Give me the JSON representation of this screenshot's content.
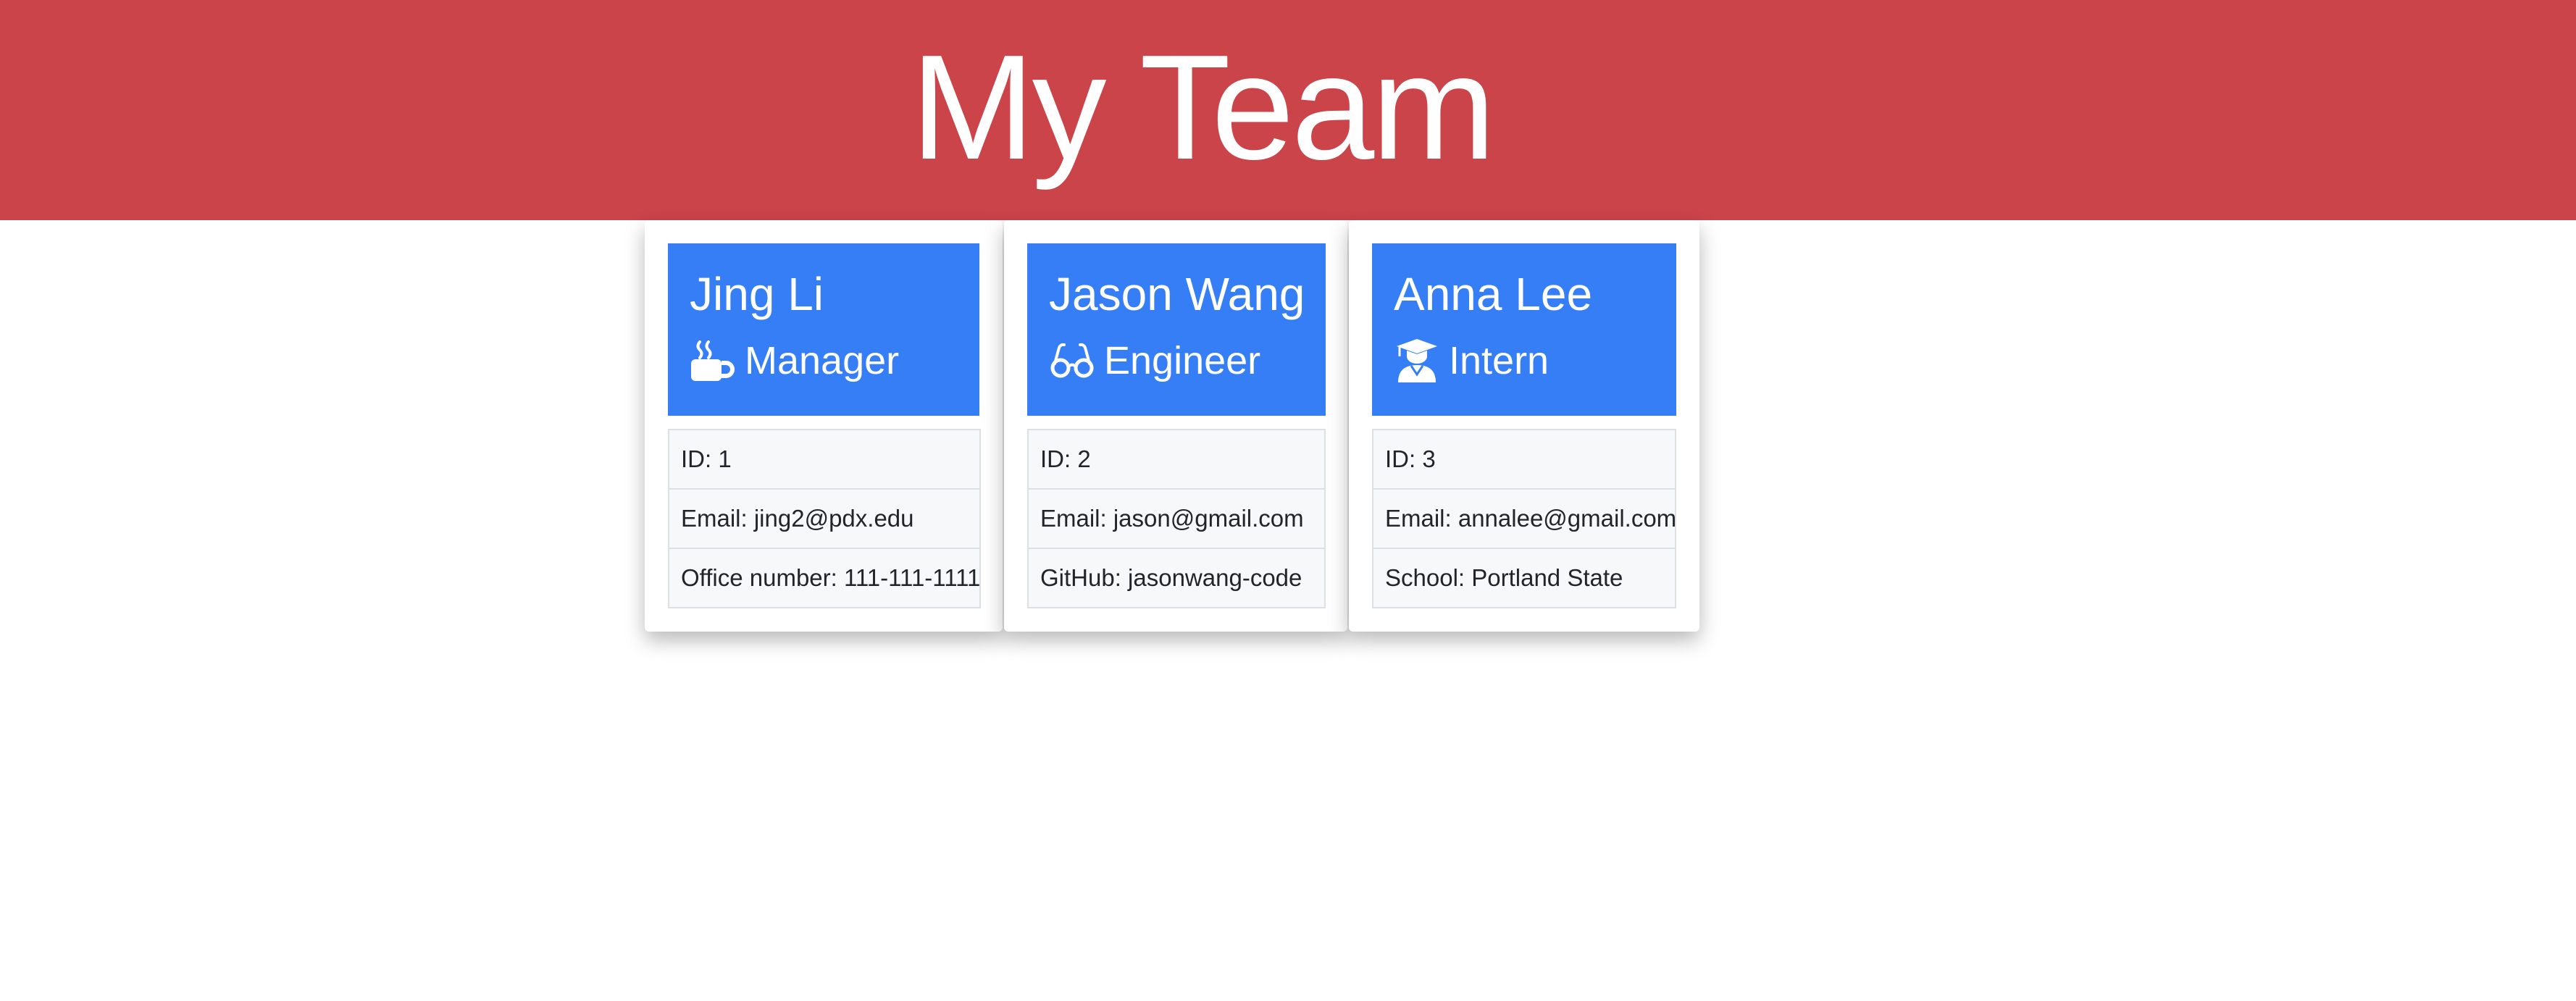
{
  "header": {
    "title": "My Team"
  },
  "team": [
    {
      "name": "Jing Li",
      "role": "Manager",
      "role_icon": "coffee-mug-icon",
      "details": [
        "ID: 1",
        "Email: jing2@pdx.edu",
        "Office number: 111-111-1111"
      ]
    },
    {
      "name": "Jason Wang",
      "role": "Engineer",
      "role_icon": "glasses-icon",
      "details": [
        "ID: 2",
        "Email: jason@gmail.com",
        "GitHub: jasonwang-code"
      ]
    },
    {
      "name": "Anna Lee",
      "role": "Intern",
      "role_icon": "graduate-icon",
      "details": [
        "ID: 3",
        "Email: annalee@gmail.com",
        "School: Portland State"
      ]
    }
  ],
  "colors": {
    "header_bg": "#cb444a",
    "card_head_bg": "#367ef6",
    "list_bg": "#f7f8fa"
  }
}
